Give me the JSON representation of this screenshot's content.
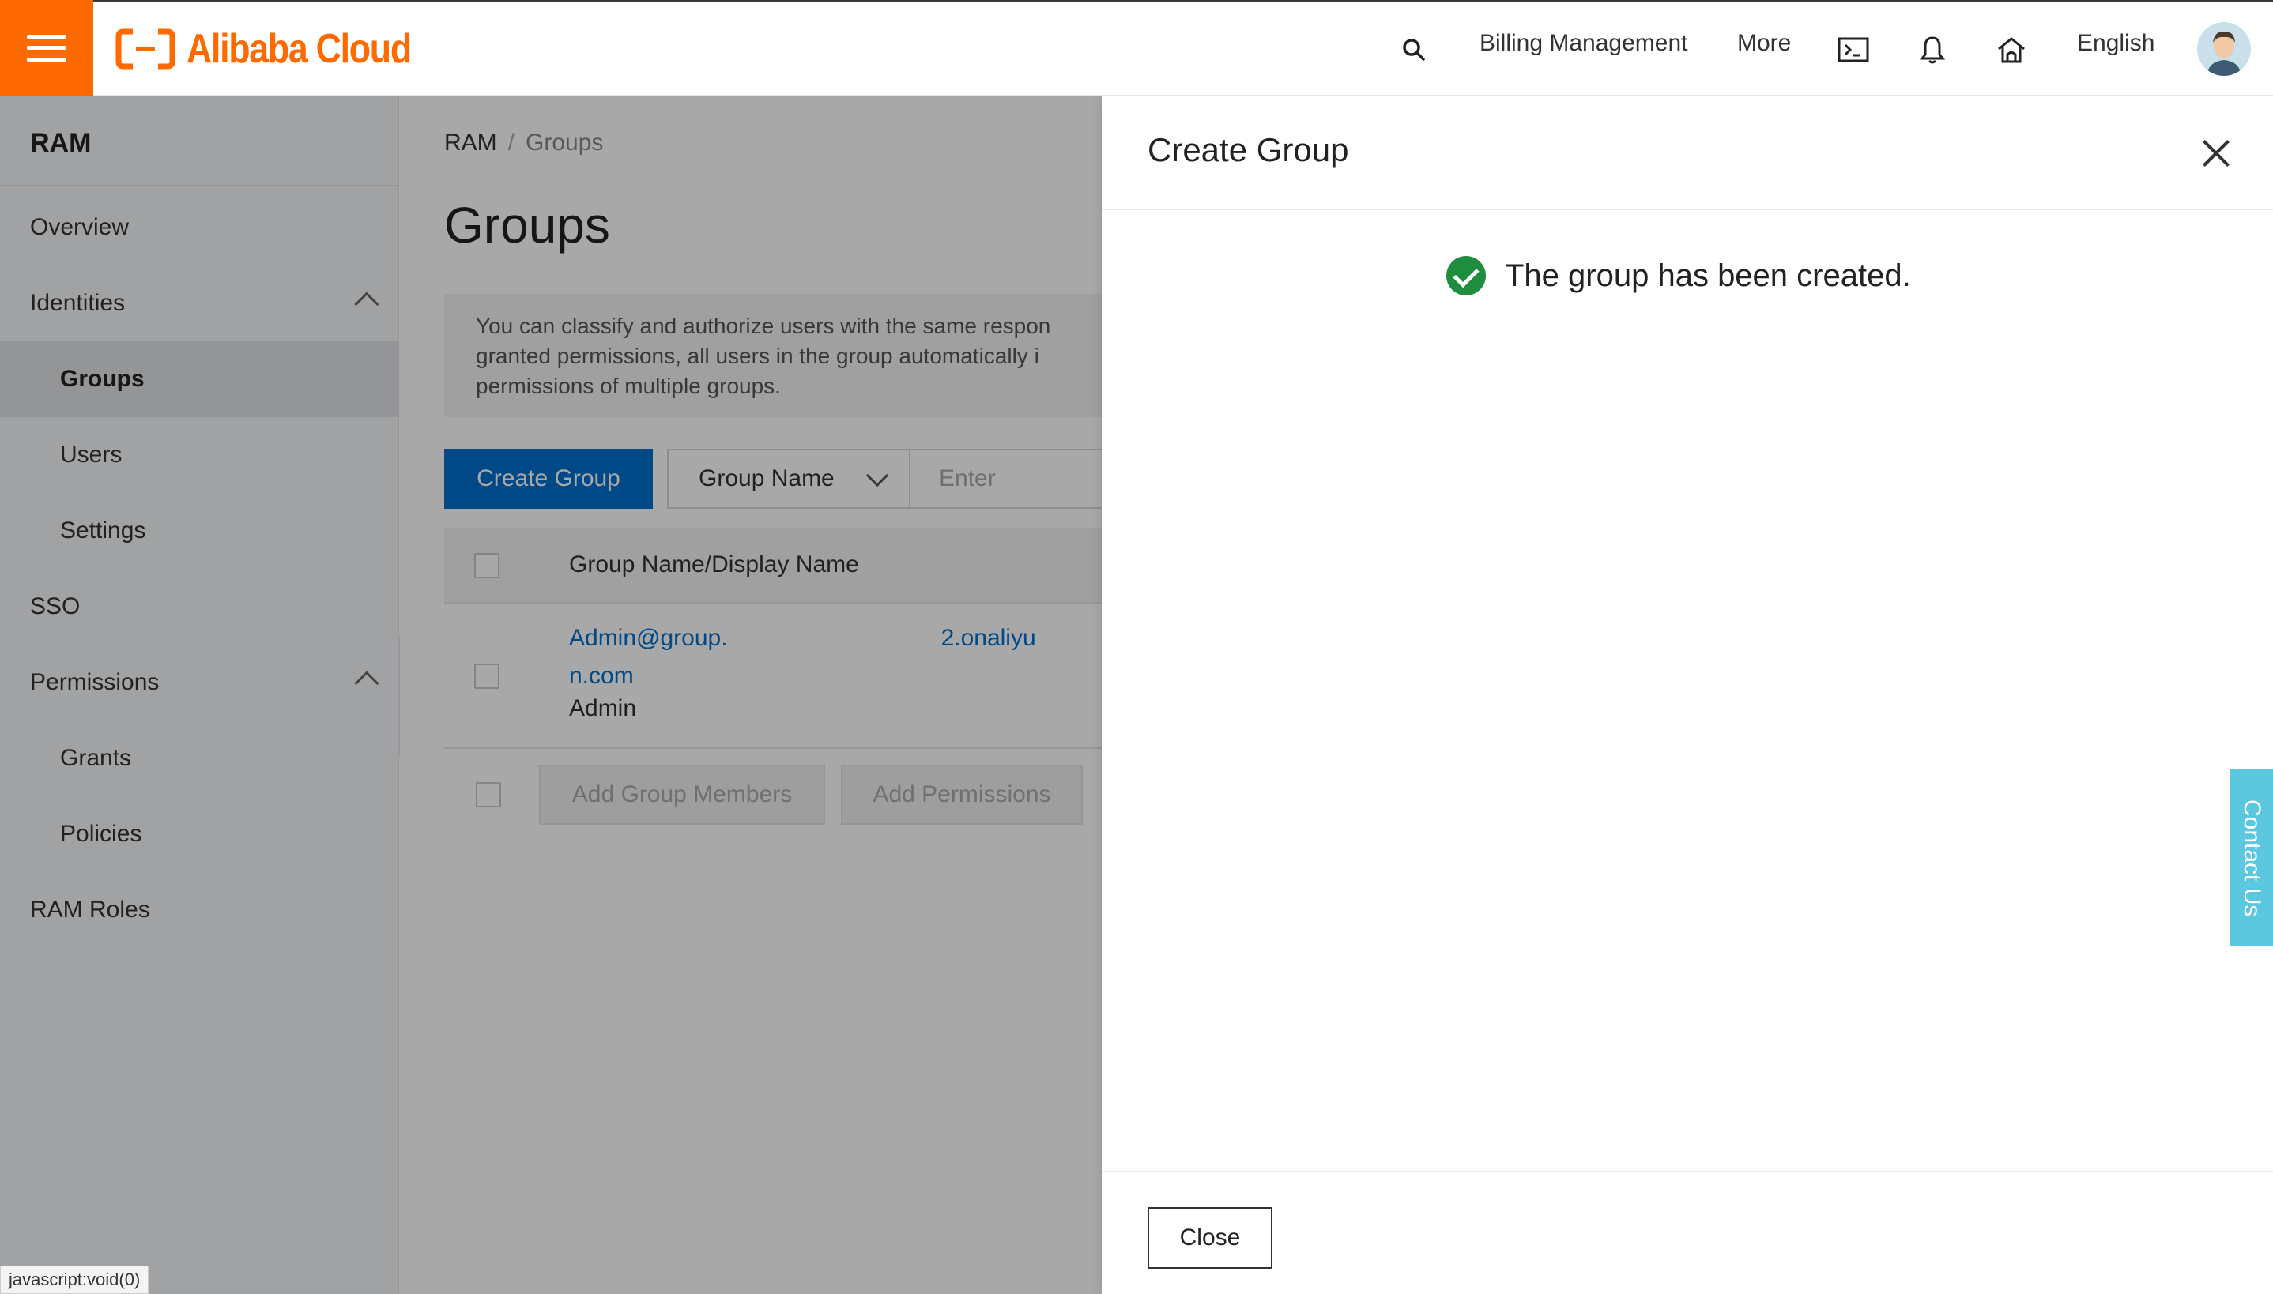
{
  "topbar": {
    "brand": "Alibaba Cloud",
    "billing_label": "Billing Management",
    "more_label": "More",
    "language_label": "English"
  },
  "sidebar": {
    "title": "RAM",
    "items": [
      {
        "label": "Overview"
      },
      {
        "label": "Identities"
      },
      {
        "label": "Groups"
      },
      {
        "label": "Users"
      },
      {
        "label": "Settings"
      },
      {
        "label": "SSO"
      },
      {
        "label": "Permissions"
      },
      {
        "label": "Grants"
      },
      {
        "label": "Policies"
      },
      {
        "label": "RAM Roles"
      }
    ]
  },
  "main": {
    "breadcrumb": {
      "root": "RAM",
      "separator": "/",
      "current": "Groups"
    },
    "title": "Groups",
    "info_lines": [
      "You can classify and authorize users with the same respon",
      "granted permissions, all users in the group automatically i",
      "permissions of multiple groups."
    ],
    "create_button": "Create Group",
    "filter_select": "Group Name",
    "search_placeholder": "Enter",
    "table": {
      "column_header": "Group Name/Display Name",
      "rows": [
        {
          "name_prefix": "Admin@group.",
          "name_suffix": "2.onaliyu",
          "name_line2": "n.com",
          "display_name": "Admin"
        }
      ]
    },
    "bulk_actions": {
      "add_members": "Add Group Members",
      "add_permissions": "Add Permissions"
    }
  },
  "drawer": {
    "title": "Create Group",
    "success_message": "The group has been created.",
    "close_button": "Close"
  },
  "contact_us": "Contact Us",
  "status_bar_url": "javascript:void(0)",
  "colors": {
    "brand_orange": "#ff6a00",
    "primary_blue": "#0070cc",
    "success_green": "#1e8e3e",
    "contact_cyan": "#5bc8e0"
  }
}
